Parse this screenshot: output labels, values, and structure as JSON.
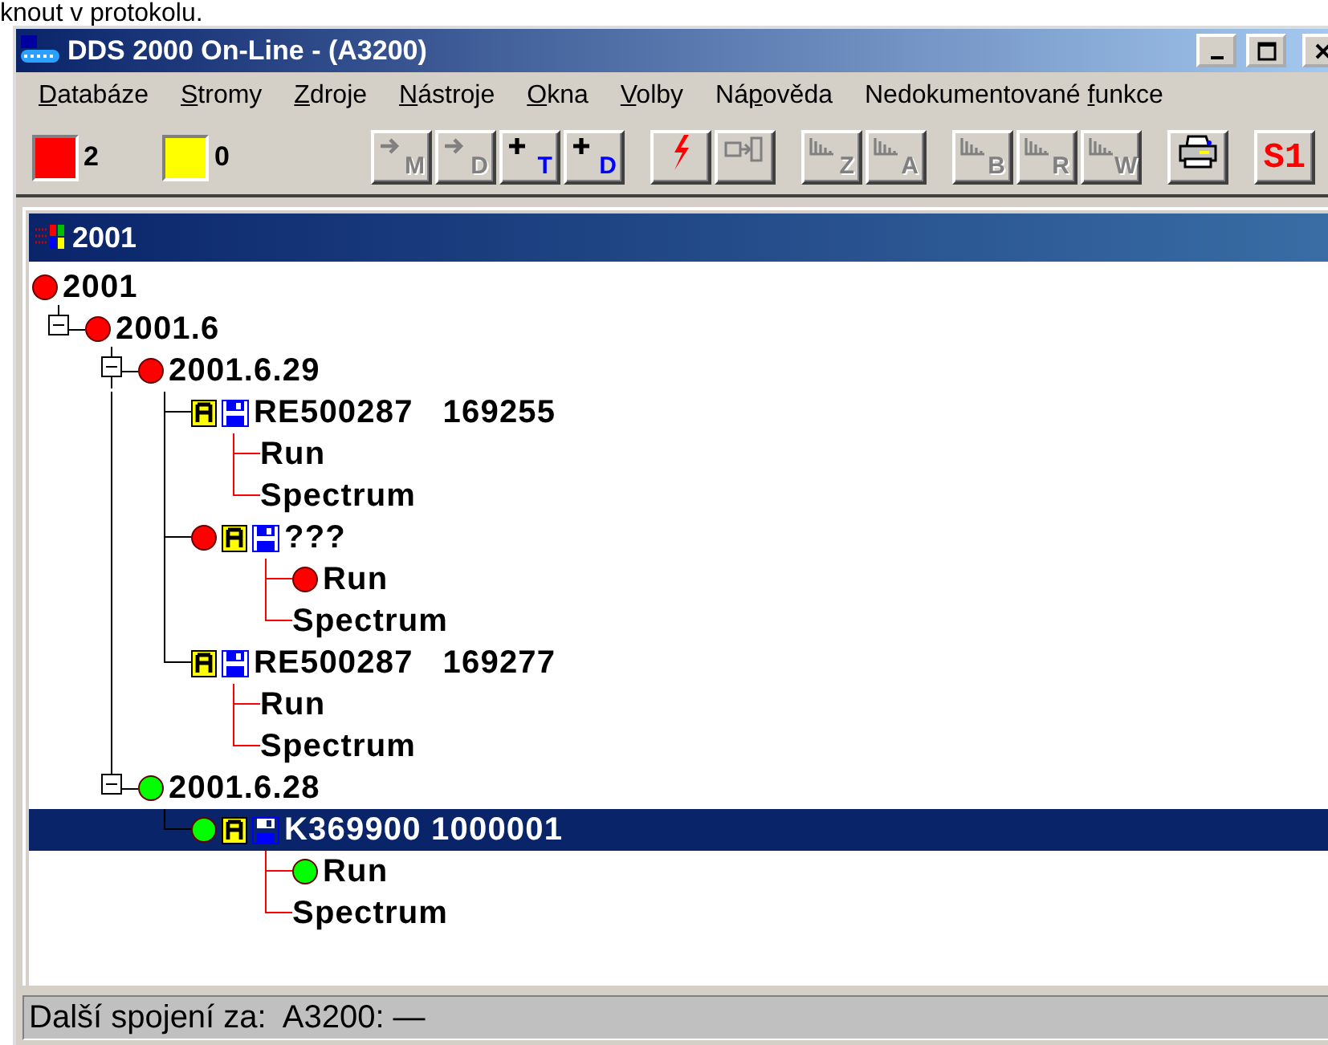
{
  "caption": "knout v protokolu.",
  "window": {
    "title": "DDS 2000 On-Line - (A3200)"
  },
  "menu": [
    {
      "hotkey": "D",
      "rest": "atabáze"
    },
    {
      "hotkey": "S",
      "rest": "tromy"
    },
    {
      "hotkey": "Z",
      "rest": "droje"
    },
    {
      "hotkey": "N",
      "rest": "ástroje"
    },
    {
      "hotkey": "O",
      "rest": "kna"
    },
    {
      "hotkey": "V",
      "rest": "olby"
    },
    {
      "lead": "Ná",
      "hotkey": "p",
      "rest": "ověda"
    },
    {
      "lead": "Nedokumentované ",
      "hotkey": "f",
      "rest": "unkce"
    }
  ],
  "toolbar": {
    "counters": [
      {
        "color": "#ff0000",
        "count": "2"
      },
      {
        "color": "#ffff00",
        "count": "0"
      }
    ],
    "groups": [
      [
        {
          "kind": "arrow",
          "label": "M",
          "disabled": true
        },
        {
          "kind": "arrow",
          "label": "D",
          "disabled": true
        },
        {
          "kind": "plus",
          "label": "T",
          "disabled": false
        },
        {
          "kind": "plus",
          "label": "D",
          "disabled": false
        }
      ],
      [
        {
          "kind": "bolt",
          "disabled": false
        },
        {
          "kind": "plug",
          "disabled": true
        }
      ],
      [
        {
          "kind": "chart",
          "label": "Z",
          "disabled": true
        },
        {
          "kind": "chart",
          "label": "A",
          "disabled": true
        }
      ],
      [
        {
          "kind": "chart",
          "label": "B",
          "disabled": true
        },
        {
          "kind": "chart",
          "label": "R",
          "disabled": true
        },
        {
          "kind": "chart",
          "label": "W",
          "disabled": true
        }
      ],
      [
        {
          "kind": "printer",
          "disabled": false
        }
      ],
      [
        {
          "kind": "text",
          "label": "S1",
          "disabled": false
        }
      ]
    ]
  },
  "document": {
    "title": "2001",
    "tree": [
      {
        "label": "2001",
        "kind": "root",
        "color": "#ff0000",
        "selected": false,
        "children": [
          {
            "label": "2001.6",
            "kind": "folder",
            "expanded": true,
            "color": "#ff0000",
            "selected": false,
            "children": [
              {
                "label": "2001.6.29",
                "kind": "folder",
                "expanded": true,
                "color": "#ff0000",
                "selected": false,
                "children": [
                  {
                    "label": "RE500287   169255",
                    "kind": "record",
                    "selected": false,
                    "children": [
                      {
                        "label": "Run",
                        "kind": "data",
                        "selected": false
                      },
                      {
                        "label": "Spectrum",
                        "kind": "data",
                        "selected": false
                      }
                    ]
                  },
                  {
                    "label": "???",
                    "kind": "record",
                    "color": "#ff0000",
                    "selected": false,
                    "children": [
                      {
                        "label": "Run",
                        "kind": "data",
                        "color": "#ff0000",
                        "selected": false
                      },
                      {
                        "label": "Spectrum",
                        "kind": "data",
                        "selected": false
                      }
                    ]
                  },
                  {
                    "label": "RE500287   169277",
                    "kind": "record",
                    "selected": false,
                    "children": [
                      {
                        "label": "Run",
                        "kind": "data",
                        "selected": false
                      },
                      {
                        "label": "Spectrum",
                        "kind": "data",
                        "selected": false
                      }
                    ]
                  }
                ]
              },
              {
                "label": "2001.6.28",
                "kind": "folder",
                "expanded": true,
                "color": "#00ff00",
                "selected": false,
                "children": [
                  {
                    "label": "K369900 1000001",
                    "kind": "record",
                    "color": "#00ff00",
                    "selected": true,
                    "children": [
                      {
                        "label": "Run",
                        "kind": "data",
                        "color": "#00ff00",
                        "selected": false
                      },
                      {
                        "label": "Spectrum",
                        "kind": "data",
                        "selected": false
                      }
                    ]
                  }
                ]
              }
            ]
          }
        ]
      }
    ]
  },
  "status_bar": "Další spojení za:  A3200: —"
}
